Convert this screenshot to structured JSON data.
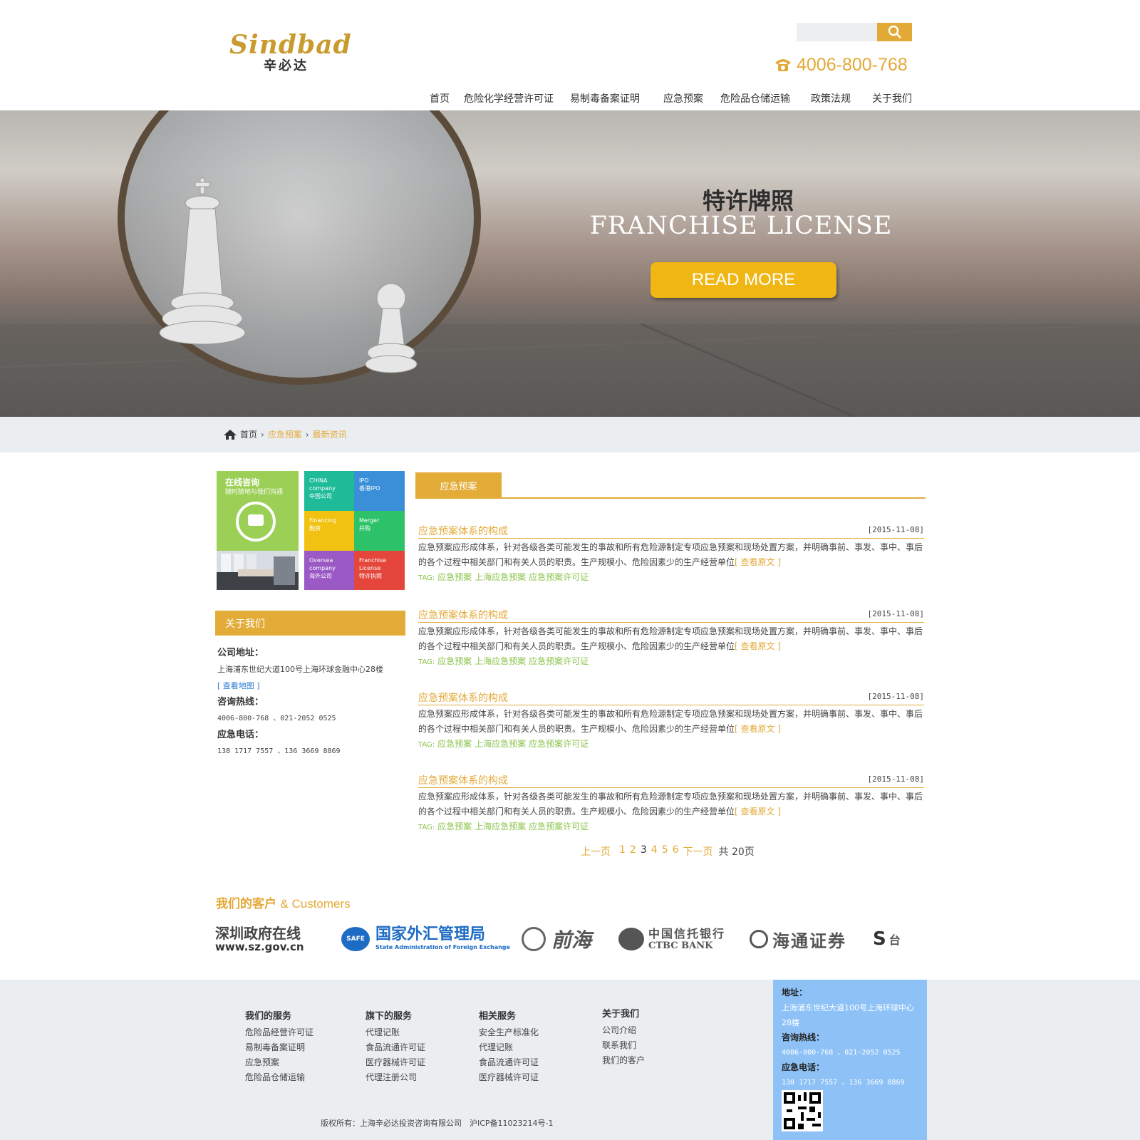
{
  "header": {
    "logo_en": "Sindbad",
    "logo_cn": "辛必达",
    "search_placeholder": "",
    "phone": "4006-800-768"
  },
  "nav": [
    "首页",
    "危险化学经营许可证",
    "易制毒备案证明",
    "应急预案",
    "危险品仓储运输",
    "政策法规",
    "关于我们"
  ],
  "banner": {
    "title_cn": "特许牌照",
    "title_en": "FRANCHISE LICENSE",
    "button": "READ MORE"
  },
  "breadcrumb": {
    "home": "首页",
    "level1": "应急预案",
    "level2": "最新资讯"
  },
  "sidebar": {
    "consult_title": "在线咨询",
    "consult_sub": "随时随地与我们沟通",
    "tiles": [
      {
        "en": "CHINA company",
        "cn": "中国公司"
      },
      {
        "en": "IPO",
        "cn": "香港IPO"
      },
      {
        "en": "Financing",
        "cn": "融资"
      },
      {
        "en": "Merger",
        "cn": "并购"
      },
      {
        "en": "Oversea company",
        "cn": "海外公司"
      },
      {
        "en": "Franchise License",
        "cn": "特许执照"
      }
    ],
    "about_title": "关于我们",
    "address_label": "公司地址：",
    "address": "上海浦东世纪大道100号上海环球金融中心28楼",
    "map_link": "[ 查看地图 ]",
    "hotline_label": "咨询热线：",
    "hotline": "4006-800-768 、021-2052 0525",
    "emergency_label": "应急电话：",
    "emergency": "138 1717 7557 、136 3669 8869"
  },
  "main": {
    "tab": "应急预案",
    "items": [
      {
        "title": "应急预案体系的构成",
        "date": "[2015-11-08]",
        "desc": "应急预案应形成体系，针对各级各类可能发生的事故和所有危险源制定专项应急预案和现场处置方案，并明确事前、事发、事中、事后的各个过程中相关部门和有关人员的职责。生产规模小、危险因素少的生产经营单位",
        "more": "[ 查看原文 ]",
        "tag_label": "TAG:",
        "tags": [
          "应急预案",
          "上海应急预案",
          "应急预案许可证"
        ]
      },
      {
        "title": "应急预案体系的构成",
        "date": "[2015-11-08]",
        "desc": "应急预案应形成体系，针对各级各类可能发生的事故和所有危险源制定专项应急预案和现场处置方案，并明确事前、事发、事中、事后的各个过程中相关部门和有关人员的职责。生产规模小、危险因素少的生产经营单位",
        "more": "[ 查看原文 ]",
        "tag_label": "TAG:",
        "tags": [
          "应急预案",
          "上海应急预案",
          "应急预案许可证"
        ]
      },
      {
        "title": "应急预案体系的构成",
        "date": "[2015-11-08]",
        "desc": "应急预案应形成体系，针对各级各类可能发生的事故和所有危险源制定专项应急预案和现场处置方案，并明确事前、事发、事中、事后的各个过程中相关部门和有关人员的职责。生产规模小、危险因素少的生产经营单位",
        "more": "[ 查看原文 ]",
        "tag_label": "TAG:",
        "tags": [
          "应急预案",
          "上海应急预案",
          "应急预案许可证"
        ]
      },
      {
        "title": "应急预案体系的构成",
        "date": "[2015-11-08]",
        "desc": "应急预案应形成体系，针对各级各类可能发生的事故和所有危险源制定专项应急预案和现场处置方案，并明确事前、事发、事中、事后的各个过程中相关部门和有关人员的职责。生产规模小、危险因素少的生产经营单位",
        "more": "[ 查看原文 ]",
        "tag_label": "TAG:",
        "tags": [
          "应急预案",
          "上海应急预案",
          "应急预案许可证"
        ]
      }
    ],
    "pager": {
      "prev": "上一页",
      "pages": [
        "1",
        "2",
        "3",
        "4",
        "5",
        "6"
      ],
      "current_page": "3",
      "next": "下一页",
      "total": "共 20页"
    }
  },
  "customers": {
    "title_cn": "我们的客户",
    "title_en": "& Customers",
    "logos": [
      {
        "cn": "深圳政府在线",
        "en": "www.sz.gov.cn"
      },
      {
        "badge": "SAFE",
        "cn": "国家外汇管理局",
        "en": "State Administration of Foreign Exchange"
      },
      {
        "cn": "前海"
      },
      {
        "cn": "中国信托银行",
        "en": "CTBC BANK"
      },
      {
        "cn": "海通证券"
      },
      {
        "cn": "台"
      }
    ]
  },
  "footer": {
    "columns": [
      {
        "title": "我们的服务",
        "items": [
          "危险品经营许可证",
          "易制毒备案证明",
          "应急预案",
          "危险品仓储运输"
        ]
      },
      {
        "title": "旗下的服务",
        "items": [
          "代理记账",
          "食品流通许可证",
          "医疗器械许可证",
          "代理注册公司"
        ]
      },
      {
        "title": "相关服务",
        "items": [
          "安全生产标准化",
          "代理记账",
          "食品流通许可证",
          "医疗器械许可证"
        ]
      },
      {
        "title": "关于我们",
        "items": [
          "公司介绍",
          "联系我们",
          "我们的客户"
        ]
      }
    ],
    "contact": {
      "address_label": "地址：",
      "address": "上海浦东世纪大道100号上海环球中心28楼",
      "hotline_label": "咨询热线：",
      "hotline": "4006-800-768 、021-2052 0525",
      "emergency_label": "应急电话：",
      "emergency": "138 1717 7557 、136 3669 8869"
    },
    "copyright": "版权所有：上海辛必达投资咨询有限公司　沪ICP备11023214号-1"
  },
  "colors": {
    "accent": "#e3a937",
    "tag_green": "#8bc34a",
    "footer_bg": "#ebeef1",
    "contact_bg": "#8ec2f7"
  }
}
